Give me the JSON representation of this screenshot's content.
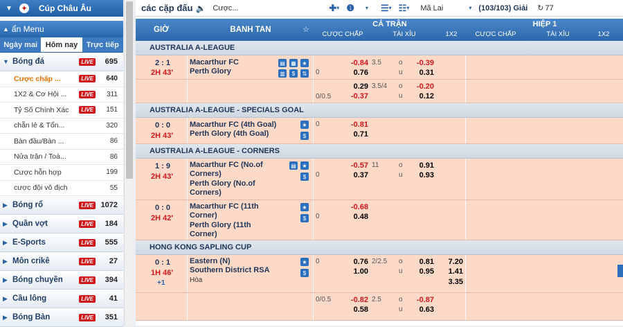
{
  "sidebar": {
    "top_button": "Cúp Châu Âu",
    "menu_header": "ẩn Menu",
    "tabs": [
      "Ngày mai",
      "Hôm nay",
      "Trực tiếp"
    ],
    "live_label": "LIVE",
    "football": {
      "name": "Bóng đá",
      "count": "695"
    },
    "subs": [
      {
        "name": "Cược chấp ...",
        "count": "640"
      },
      {
        "name": "1X2 & Cơ Hội ...",
        "count": "311"
      },
      {
        "name": "Tỷ Số Chính Xác",
        "count": "151"
      },
      {
        "name": "chẵn lẻ & Tổn...",
        "count": "320"
      },
      {
        "name": "Bàn đầu/Bàn ...",
        "count": "86"
      },
      {
        "name": "Nửa trận / Toà...",
        "count": "86"
      },
      {
        "name": "Cược hỗn hợp",
        "count": "199"
      },
      {
        "name": "cược đội vô địch",
        "count": "55"
      }
    ],
    "sports": [
      {
        "name": "Bóng rổ",
        "count": "1072"
      },
      {
        "name": "Quần vợt",
        "count": "184"
      },
      {
        "name": "E-Sports",
        "count": "555"
      },
      {
        "name": "Môn crikê",
        "count": "27"
      },
      {
        "name": "Bóng chuyền",
        "count": "394"
      },
      {
        "name": "Cầu lông",
        "count": "41"
      },
      {
        "name": "Bóng Bàn",
        "count": "351"
      }
    ]
  },
  "toolbar": {
    "title": "các cặp đấu",
    "search_value": "Cược...",
    "odds_type": "Mã Lai",
    "count": "(103/103) Giải",
    "refresh": "77"
  },
  "header": {
    "gio": "GIỜ",
    "banh_tan": "BANH TAN",
    "ca_tran": "CẢ TRẬN",
    "hiep1": "HIỆP 1",
    "cuoc_chap": "CƯỢC CHẤP",
    "tai_xiu": "TÀI XỈU",
    "x12": "1X2",
    "cuoc_chap2": "CƯỢC CHẤP",
    "tai_xiu2": "TÀI XỈU",
    "x12b": "1X2"
  },
  "leagues": {
    "l1": "AUSTRALIA A-LEAGUE",
    "l2": "AUSTRALIA A-LEAGUE - SPECIALS GOAL",
    "l3": "AUSTRALIA A-LEAGUE - CORNERS",
    "l4": "HONG KONG SAPLING CUP"
  },
  "m1": {
    "score": "2 : 1",
    "time": "2H 43'",
    "home": "Macarthur FC",
    "away": "Perth Glory",
    "h1": "-0.84",
    "a1": "0.76",
    "hc1": "0",
    "tx": "3.5",
    "o1": "-0.39",
    "u1": "0.31",
    "ou_o": "o",
    "ou_u": "u",
    "hc2": "0/0.5",
    "h2": "0.29",
    "a2": "-0.37",
    "tx2": "3.5/4",
    "o2": "-0.20",
    "u2": "0.12"
  },
  "m2": {
    "score": "0 : 0",
    "time": "2H 43'",
    "home": "Macarthur FC (4th Goal)",
    "away": "Perth Glory (4th Goal)",
    "hc": "0",
    "h": "-0.81",
    "a": "0.71"
  },
  "m3": {
    "score": "1 : 9",
    "time": "2H 43'",
    "home1": "Macarthur FC (No.of",
    "home2": "Corners)",
    "away1": "Perth Glory (No.of",
    "away2": "Corners)",
    "hc": "0",
    "h": "-0.57",
    "a": "0.37",
    "tx": "11",
    "o": "0.91",
    "u": "0.93",
    "ou_o": "o",
    "ou_u": "u"
  },
  "m4": {
    "score": "0 : 0",
    "time": "2H 42'",
    "home1": "Macarthur FC (11th",
    "home2": "Corner)",
    "away1": "Perth Glory (11th",
    "away2": "Corner)",
    "hc": "0",
    "h": "-0.68",
    "a": "0.48"
  },
  "m5": {
    "score": "0 : 1",
    "time": "1H 46'",
    "extra": "+1",
    "home": "Eastern (N)",
    "away": "Southern District RSA",
    "draw": "Hòa",
    "hc": "0",
    "h": "0.76",
    "a": "1.00",
    "tx": "2/2.5",
    "o": "0.81",
    "u": "0.95",
    "ou_o": "o",
    "ou_u": "u",
    "x1": "7.20",
    "x2": "1.41",
    "xd": "3.35",
    "hc2": "0/0.5",
    "h2": "-0.82",
    "a2": "0.58",
    "tx2": "2.5",
    "o2": "-0.87",
    "u2": "0.63"
  }
}
